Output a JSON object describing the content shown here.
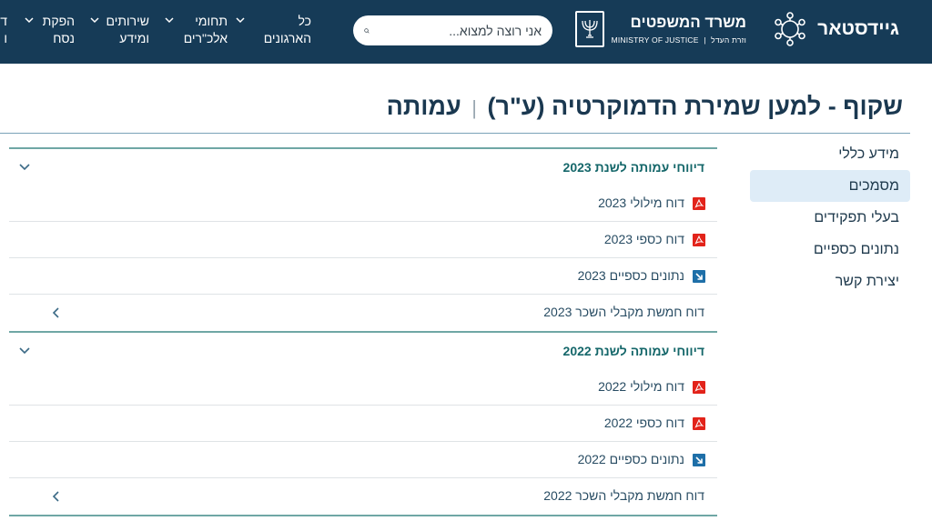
{
  "header": {
    "brand": "גיידסטאר",
    "ministry_he": "משרד המשפטים",
    "ministry_en": "MINISTRY OF JUSTICE | משרד המשפטים",
    "ministry_en_visible": "MINISTRY OF JUSTICE",
    "ministry_sub": "וזרת העדל",
    "search_placeholder": "אני רוצה למצוא...",
    "nav": [
      {
        "line1": "כל",
        "line2": "הארגונים"
      },
      {
        "line1": "תחומי",
        "line2": "אלכ\"רים"
      },
      {
        "line1": "שירותים",
        "line2": "ומידע"
      },
      {
        "line1": "הפקת",
        "line2": "נסח"
      },
      {
        "line1": "ד",
        "line2": "ו"
      }
    ],
    "colors": {
      "bar": "#163b57",
      "accent": "#15676a"
    }
  },
  "page": {
    "title_main": "שקוף - למען שמירת הדמוקרטיה (ע\"ר)",
    "title_sep": "|",
    "title_type": "עמותה"
  },
  "sidebar": {
    "items": [
      {
        "label": "מידע כללי"
      },
      {
        "label": "מסמכים"
      },
      {
        "label": "בעלי תפקידים"
      },
      {
        "label": "נתונים כספיים"
      },
      {
        "label": "יצירת קשר"
      }
    ]
  },
  "sections": [
    {
      "title": "דיווחי עמותה לשנת 2023",
      "rows": [
        {
          "label": "דוח מילולי 2023",
          "icon": "pdf-icon"
        },
        {
          "label": "דוח כספי 2023",
          "icon": "pdf-icon"
        },
        {
          "label": "נתונים כספיים 2023",
          "icon": "external-link-icon"
        },
        {
          "label": "דוח חמשת מקבלי השכר 2023",
          "icon": "chevron-left-icon"
        }
      ]
    },
    {
      "title": "דיווחי עמותה לשנת 2022",
      "rows": [
        {
          "label": "דוח מילולי 2022",
          "icon": "pdf-icon"
        },
        {
          "label": "דוח כספי 2022",
          "icon": "pdf-icon"
        },
        {
          "label": "נתונים כספיים 2022",
          "icon": "external-link-icon"
        },
        {
          "label": "דוח חמשת מקבלי השכר 2022",
          "icon": "chevron-left-icon"
        }
      ]
    }
  ]
}
